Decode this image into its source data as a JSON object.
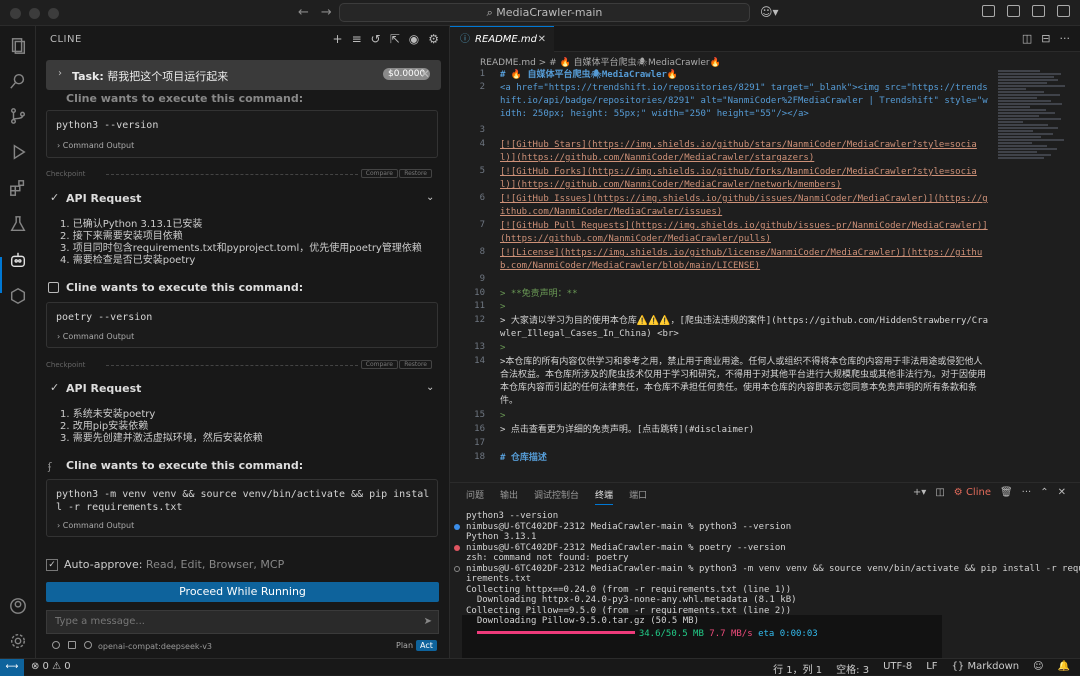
{
  "window": {
    "search": "MediaCrawler-main"
  },
  "sidebar": {
    "title": "CLINE",
    "task": {
      "label": "Task:",
      "text": "帮我把这个项目运行起来",
      "cost": "$0.0000"
    },
    "partial_header": "Cline wants to execute this command:",
    "command_header": "Cline wants to execute this command:",
    "command_output": "Command Output",
    "checkpoint": {
      "label": "Checkpoint",
      "compare": "Compare",
      "restore": "Restore"
    },
    "api_request": "API Request",
    "cmd1": "python3 --version",
    "api1": [
      "1. 已确认Python 3.13.1已安装",
      "2. 接下来需要安装项目依赖",
      "3. 项目同时包含requirements.txt和pyproject.toml，优先使用poetry管理依赖",
      "4. 需要检查是否已安装poetry"
    ],
    "cmd2": "poetry --version",
    "api2": [
      "1. 系统未安装poetry",
      "2. 改用pip安装依赖",
      "3. 需要先创建并激活虚拟环境，然后安装依赖"
    ],
    "cmd3": "python3 -m venv venv && source venv/bin/activate && pip install -r requirements.txt",
    "auto_approve": {
      "label": "Auto-approve:",
      "value": "Read, Edit, Browser, MCP"
    },
    "proceed": "Proceed While Running",
    "message_placeholder": "Type a message...",
    "model": "openai-compat:deepseek-v3",
    "plan": "Plan",
    "act": "Act"
  },
  "editor": {
    "tab": "README.md",
    "breadcrumb": "README.md > # 🔥 自媒体平台爬虫🕷MediaCrawler🔥",
    "lines": [
      {
        "n": "1",
        "t": "# 🔥 自媒体平台爬虫🕷MediaCrawler🔥"
      },
      {
        "n": "2",
        "t": "<a href=\"https://trendshift.io/repositories/8291\" target=\"_blank\"><img src=\"https://trendshift.io/api/badge/repositories/8291\" alt=\"NanmiCoder%2FMediaCrawler | Trendshift\" style=\"width: 250px; height: 55px;\" width=\"250\" height=\"55\"/></a>"
      },
      {
        "n": "3",
        "t": ""
      },
      {
        "n": "4",
        "t": "[![GitHub Stars](https://img.shields.io/github/stars/NanmiCoder/MediaCrawler?style=social)](https://github.com/NanmiCoder/MediaCrawler/stargazers)"
      },
      {
        "n": "5",
        "t": "[![GitHub Forks](https://img.shields.io/github/forks/NanmiCoder/MediaCrawler?style=social)](https://github.com/NanmiCoder/MediaCrawler/network/members)"
      },
      {
        "n": "6",
        "t": "[![GitHub Issues](https://img.shields.io/github/issues/NanmiCoder/MediaCrawler)](https://github.com/NanmiCoder/MediaCrawler/issues)"
      },
      {
        "n": "7",
        "t": "[![GitHub Pull Requests](https://img.shields.io/github/issues-pr/NanmiCoder/MediaCrawler)](https://github.com/NanmiCoder/MediaCrawler/pulls)"
      },
      {
        "n": "8",
        "t": "[![License](https://img.shields.io/github/license/NanmiCoder/MediaCrawler)](https://github.com/NanmiCoder/MediaCrawler/blob/main/LICENSE)"
      },
      {
        "n": "9",
        "t": ""
      },
      {
        "n": "10",
        "t": "> **免责声明：**"
      },
      {
        "n": "11",
        "t": ">"
      },
      {
        "n": "12",
        "t": "> 大家请以学习为目的使用本仓库⚠️⚠️⚠️，[爬虫违法违规的案件](https://github.com/HiddenStrawberry/Crawler_Illegal_Cases_In_China)  <br>"
      },
      {
        "n": "13",
        "t": ">"
      },
      {
        "n": "14",
        "t": ">本仓库的所有内容仅供学习和参考之用，禁止用于商业用途。任何人或组织不得将本仓库的内容用于非法用途或侵犯他人合法权益。本仓库所涉及的爬虫技术仅用于学习和研究，不得用于对其他平台进行大规模爬虫或其他非法行为。对于因使用本仓库内容而引起的任何法律责任，本仓库不承担任何责任。使用本仓库的内容即表示您同意本免责声明的所有条款和条件。"
      },
      {
        "n": "15",
        "t": ">"
      },
      {
        "n": "16",
        "t": "> 点击查看更为详细的免责声明。[点击跳转](#disclaimer)"
      },
      {
        "n": "17",
        "t": ""
      },
      {
        "n": "18",
        "t": "# 仓库描述"
      }
    ]
  },
  "panel": {
    "tabs": [
      "问题",
      "输出",
      "调试控制台",
      "终端",
      "端口"
    ],
    "cline_label": "Cline",
    "terminal": [
      "python3 --version",
      "nimbus@U-6TC402DF-2312 MediaCrawler-main % python3 --version",
      "Python 3.13.1",
      "nimbus@U-6TC402DF-2312 MediaCrawler-main % poetry --version",
      "zsh: command not found: poetry",
      "nimbus@U-6TC402DF-2312 MediaCrawler-main % python3 -m venv venv && source venv/bin/activate && pip install -r requ",
      "irements.txt",
      "Collecting httpx==0.24.0 (from -r requirements.txt (line 1))",
      "  Downloading httpx-0.24.0-py3-none-any.whl.metadata (8.1 kB)",
      "Collecting Pillow==9.5.0 (from -r requirements.txt (line 2))",
      "  Downloading Pillow-9.5.0.tar.gz (50.5 MB)"
    ],
    "progress_text": "34.6/50.5 MB",
    "progress_speed": "7.7 MB/s",
    "progress_eta": "eta 0:00:03",
    "progress_fraction": 0.685
  },
  "statusbar": {
    "errors": "⊗ 0 ⚠ 0",
    "position": "行 1，列 1",
    "spaces": "空格: 3",
    "encoding": "UTF-8",
    "eol": "LF",
    "language": "Markdown"
  }
}
